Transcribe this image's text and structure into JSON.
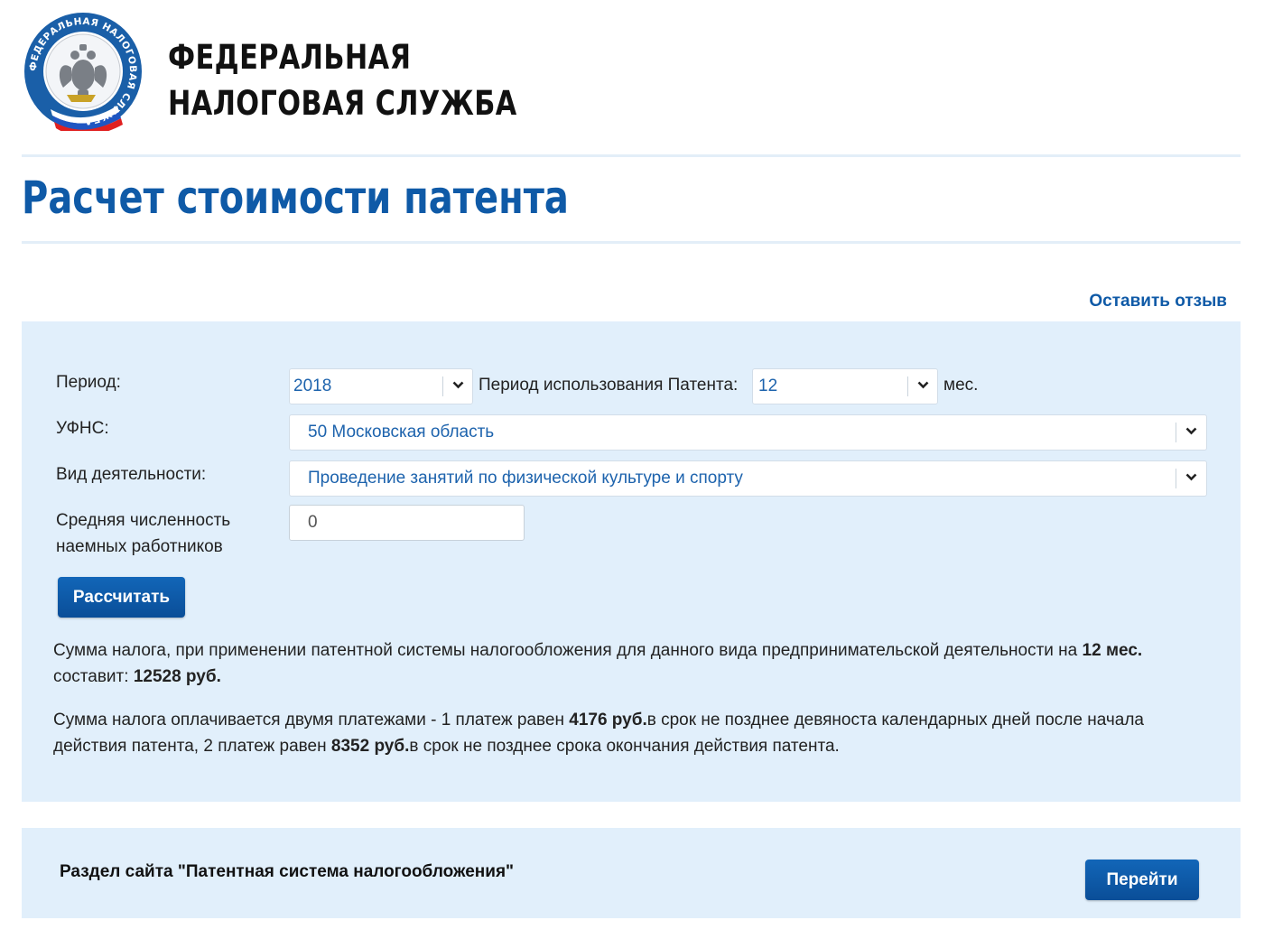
{
  "header": {
    "org_name_line1": "ФЕДЕРАЛЬНАЯ",
    "org_name_line2": "НАЛОГОВАЯ СЛУЖБА",
    "emblem_text": "ФЕДЕРАЛЬНАЯ НАЛОГОВАЯ СЛУЖБА",
    "emblem_icon": "fns-emblem-icon"
  },
  "page": {
    "title": "Расчет стоимости патента",
    "feedback_link": "Оставить отзыв"
  },
  "form": {
    "period_label": "Период:",
    "period_value": "2018",
    "usage_label": "Период использования Патента:",
    "usage_value": "12",
    "usage_unit": "мес.",
    "ufns_label": "УФНС:",
    "ufns_value": "50 Московская область",
    "activity_label": "Вид деятельности:",
    "activity_value": "Проведение занятий по физической культуре и спорту",
    "employees_label_line1": "Средняя численность",
    "employees_label_line2": "наемных работников",
    "employees_value": "0",
    "calc_button": "Рассчитать"
  },
  "result": {
    "p1_a": "Сумма налога, при применении патентной системы налогообложения для данного вида предпринимательской деятельности на ",
    "p1_months": "12 мес.",
    "p1_b": " составит: ",
    "p1_total": "12528 руб.",
    "p2_a": "Сумма налога оплачивается двумя платежами - 1 платеж равен ",
    "p2_pay1": "4176 руб.",
    "p2_b": "в срок не позднее девяноста календарных дней после начала действия патента, 2 платеж равен ",
    "p2_pay2": "8352 руб.",
    "p2_c": "в срок не позднее срока окончания действия патента."
  },
  "section": {
    "label": "Раздел сайта \"Патентная система налогообложения\"",
    "button": "Перейти"
  },
  "colors": {
    "brand_blue": "#0f5aa7",
    "link_blue": "#1d63ad",
    "panel_bg": "#e1effb",
    "button_blue": "#0a4e98"
  },
  "icons": {
    "dropdown": "chevron-down-icon"
  }
}
